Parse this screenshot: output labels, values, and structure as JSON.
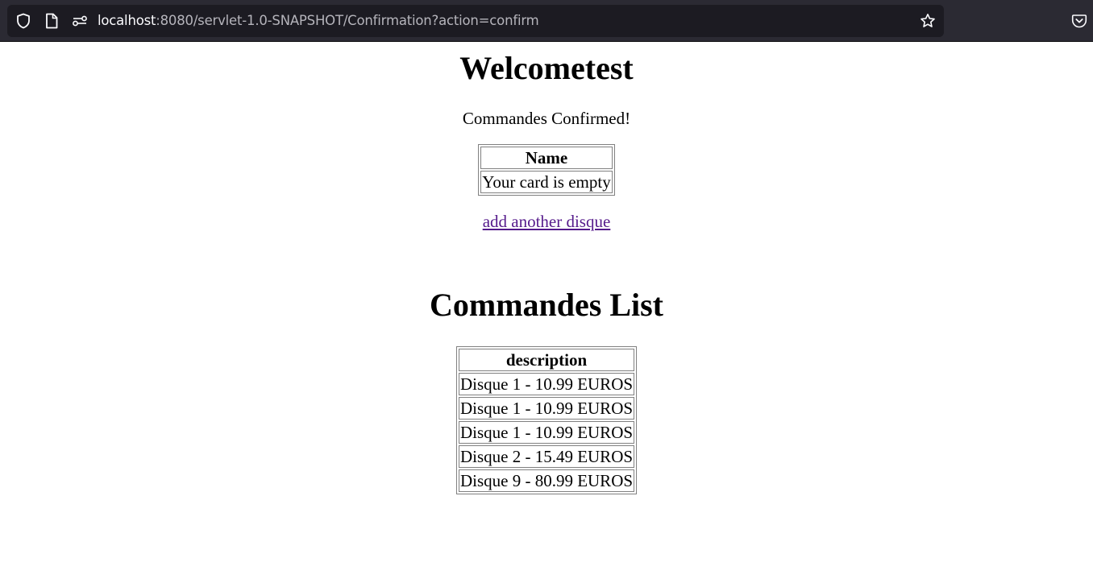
{
  "browser": {
    "url_host": "localhost",
    "url_rest": ":8080/servlet-1.0-SNAPSHOT/Confirmation?action=confirm",
    "icons": [
      "shield-icon",
      "page-icon",
      "permissions-icon",
      "bookmark-star-icon",
      "pocket-icon"
    ]
  },
  "page": {
    "welcome_title": "Welcometest",
    "confirm_message": "Commandes Confirmed!",
    "cart_table": {
      "header": "Name",
      "rows": [
        "Your card is empty"
      ]
    },
    "add_link": "add another disque",
    "list_title": "Commandes List",
    "commandes_table": {
      "header": "description",
      "rows": [
        "Disque 1 - 10.99 EUROS",
        "Disque 1 - 10.99 EUROS",
        "Disque 1 - 10.99 EUROS",
        "Disque 2 - 15.49 EUROS",
        "Disque 9 - 80.99 EUROS"
      ]
    }
  }
}
